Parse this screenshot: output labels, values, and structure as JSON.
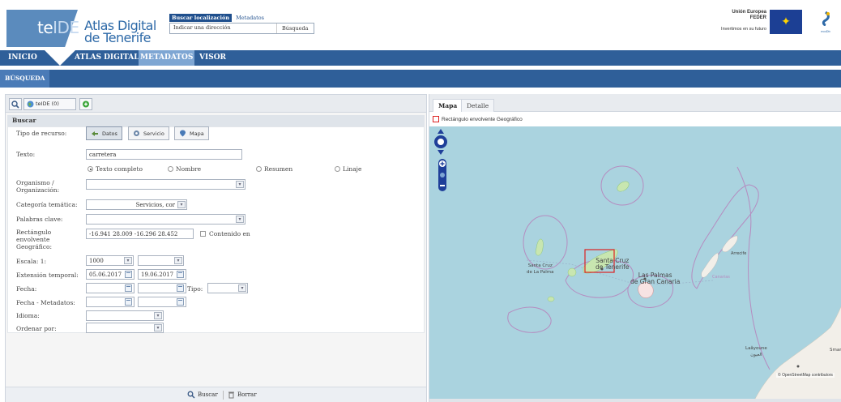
{
  "header": {
    "logo": {
      "te": "te",
      "ide": "IDE",
      "atlas_line1": "Atlas Digital",
      "atlas_line2": "de Tenerife"
    },
    "search": {
      "tab_active": "Buscar localización",
      "tab_other": "Metadatos",
      "placeholder": "Indicar una dirección",
      "button": "Búsqueda"
    },
    "eu": {
      "line1": "Unión Europea",
      "line2": "FEDER",
      "line3": "Invertimos en su futuro"
    },
    "gov_text": "ecoDb"
  },
  "nav": {
    "items": [
      {
        "label": "INICIO"
      },
      {
        "label": "ATLAS DIGITAL"
      },
      {
        "label": "METADATOS"
      },
      {
        "label": "VISOR"
      }
    ],
    "sub_item": "BÚSQUEDA"
  },
  "left_panel": {
    "toolbar": {
      "tab_label": "teIDE (0)"
    },
    "section_title": "Buscar",
    "form": {
      "tipo_recurso_label": "Tipo de recurso:",
      "resource_buttons": [
        "Datos",
        "Servicio",
        "Mapa"
      ],
      "texto_label": "Texto:",
      "texto_value": "carretera",
      "search_modes": [
        "Texto completo",
        "Nombre",
        "Resumen",
        "Linaje"
      ],
      "organismo_label_1": "Organismo /",
      "organismo_label_2": "Organización:",
      "categoria_label": "Categoría temática:",
      "categoria_value": "Servicios, cor",
      "palabras_label": "Palabras clave:",
      "rect_label_1": "Rectángulo",
      "rect_label_2": "envolvente",
      "rect_label_3": "Geográfico:",
      "rect_value": "-16.941 28.009 -16.296 28.452",
      "contenido_label": "Contenido en",
      "escala_label": "Escala: 1:",
      "escala_value": "1000",
      "extension_label": "Extensión temporal:",
      "fecha_desde": "05.06.2017",
      "fecha_hasta": "19.06.2017",
      "fecha_label": "Fecha:",
      "tipo_label": "Tipo:",
      "fecha_metadatos_label": "Fecha - Metadatos:",
      "idioma_label": "Idioma:",
      "ordenar_label": "Ordenar por:"
    },
    "bottom": {
      "buscar": "Buscar",
      "borrar": "Borrar"
    }
  },
  "right_panel": {
    "tabs": [
      "Mapa",
      "Detalle"
    ],
    "legend": "Rectángulo envolvente Geográfico",
    "labels": {
      "santa_cruz_palma_1": "Santa Cruz",
      "santa_cruz_palma_2": "de La Palma",
      "santa_cruz_tenerife_1": "Santa Cruz",
      "santa_cruz_tenerife_2": "de Tenerife",
      "las_palmas_1": "Las Palmas",
      "las_palmas_2": "de Gran Canaria",
      "arrecife": "Arrecife",
      "canarias": "Canarias",
      "laayoune_1": "Laâyoune",
      "laayoune_2": "العيون",
      "smara": "Smar",
      "attribution": "© OpenStreetMap contributors"
    }
  },
  "colors": {
    "nav": "#2f5f99",
    "nav_active": "#7ea6d3",
    "sea": "#aad3df",
    "land": "#f2efe9",
    "eez": "#b58cc0",
    "bbox": "#dd2222"
  }
}
